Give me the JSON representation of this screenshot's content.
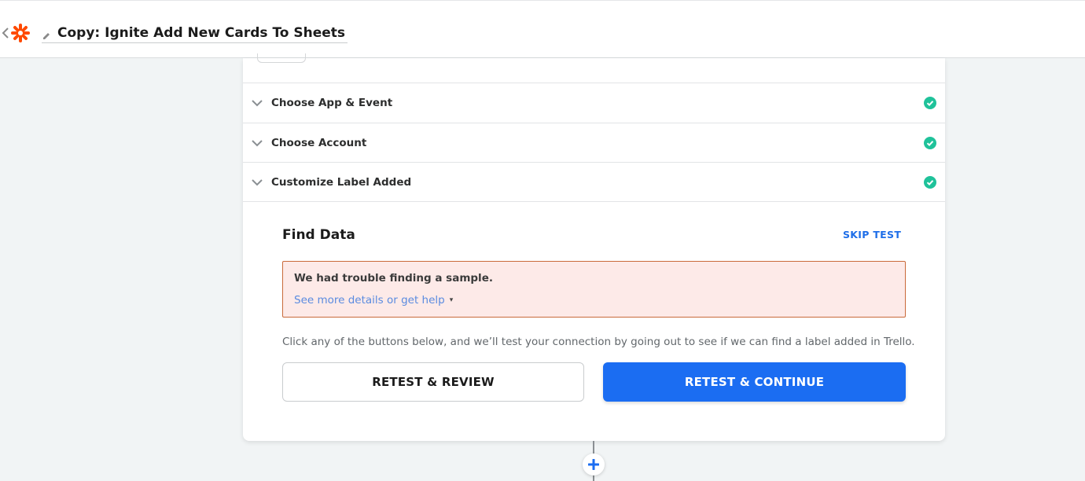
{
  "header": {
    "zap_title": "Copy: Ignite Add New Cards To Sheets",
    "brand_color": "#ff4a00"
  },
  "steps": [
    {
      "label": "Choose App & Event",
      "status": "complete"
    },
    {
      "label": "Choose Account",
      "status": "complete"
    },
    {
      "label": "Customize Label Added",
      "status": "complete"
    }
  ],
  "find_data": {
    "title": "Find Data",
    "skip_label": "SKIP TEST",
    "alert": {
      "title": "We had trouble finding a sample.",
      "link_label": "See more details or get help",
      "caret": "▾"
    },
    "description": "Click any of the buttons below, and we’ll test your connection by going out to see if we can find a label added in Trello.",
    "retest_review_label": "RETEST & REVIEW",
    "retest_continue_label": "RETEST & CONTINUE"
  },
  "colors": {
    "primary": "#1b6df2",
    "success": "#1fc29a",
    "alert_bg": "#fdeae8",
    "alert_border": "#c96a3a"
  }
}
